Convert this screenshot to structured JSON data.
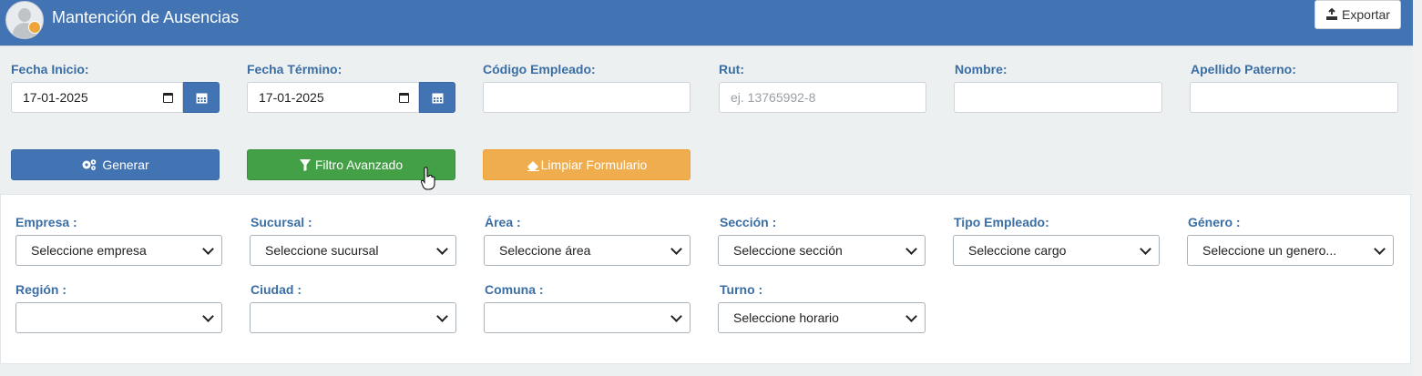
{
  "header": {
    "title": "Mantención de Ausencias",
    "export_label": "Exportar",
    "bg_color": "#4274b4"
  },
  "filters": {
    "fecha_inicio": {
      "label": "Fecha Inicio:",
      "value": "17-01-2025"
    },
    "fecha_termino": {
      "label": "Fecha Término:",
      "value": "17-01-2025"
    },
    "codigo_empleado": {
      "label": "Código Empleado:",
      "value": ""
    },
    "rut": {
      "label": "Rut:",
      "placeholder": "ej. 13765992-8"
    },
    "nombre": {
      "label": "Nombre:",
      "value": ""
    },
    "apellido_paterno": {
      "label": "Apellido Paterno:",
      "value": ""
    }
  },
  "actions": {
    "generar": "Generar",
    "filtro_avanzado": "Filtro Avanzado",
    "limpiar": "Limpiar Formulario"
  },
  "advanced": {
    "empresa": {
      "label": "Empresa :",
      "selected": "Seleccione empresa"
    },
    "sucursal": {
      "label": "Sucursal :",
      "selected": "Seleccione sucursal"
    },
    "area": {
      "label": "Área :",
      "selected": "Seleccione área"
    },
    "seccion": {
      "label": "Sección :",
      "selected": "Seleccione sección"
    },
    "tipo_empleado": {
      "label": "Tipo Empleado:",
      "selected": "Seleccione cargo"
    },
    "genero": {
      "label": "Género :",
      "selected": "Seleccione un genero..."
    },
    "region": {
      "label": "Región :",
      "selected": ""
    },
    "ciudad": {
      "label": "Ciudad :",
      "selected": ""
    },
    "comuna": {
      "label": "Comuna :",
      "selected": ""
    },
    "turno": {
      "label": "Turno :",
      "selected": "Seleccione horario"
    }
  },
  "icons": {
    "calendar": "calendar-icon",
    "gears": "gears-icon",
    "filter": "filter-icon",
    "eraser": "eraser-icon",
    "export": "export-icon",
    "chevron": "chevron-down-icon"
  }
}
